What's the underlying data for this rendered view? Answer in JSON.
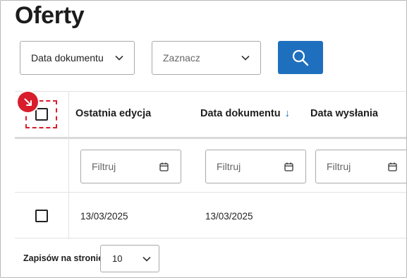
{
  "page": {
    "title": "Oferty"
  },
  "toolbar": {
    "doc_date_select": {
      "value": "Data dokumentu"
    },
    "mark_select": {
      "placeholder": "Zaznacz"
    },
    "search_button": {
      "icon": "search-icon",
      "color": "#1f6fbf"
    }
  },
  "table": {
    "columns": [
      {
        "label": "Ostatnia edycja"
      },
      {
        "label": "Data dokumentu",
        "sort": "descending",
        "sort_icon": "arrow-down-icon"
      },
      {
        "label": "Data wysłania"
      }
    ],
    "select_all_badge": {
      "icon": "arrow-down-right-icon",
      "color": "#d81e2c"
    },
    "filters": [
      {
        "placeholder": "Filtruj",
        "icon": "calendar-icon"
      },
      {
        "placeholder": "Filtruj",
        "icon": "calendar-icon"
      },
      {
        "placeholder": "Filtruj",
        "icon": "calendar-icon"
      }
    ],
    "rows": [
      {
        "selected": false,
        "cells": [
          "13/03/2025",
          "13/03/2025",
          ""
        ]
      }
    ]
  },
  "pagination": {
    "label": "Zapisów na stronie",
    "page_size": "10"
  }
}
